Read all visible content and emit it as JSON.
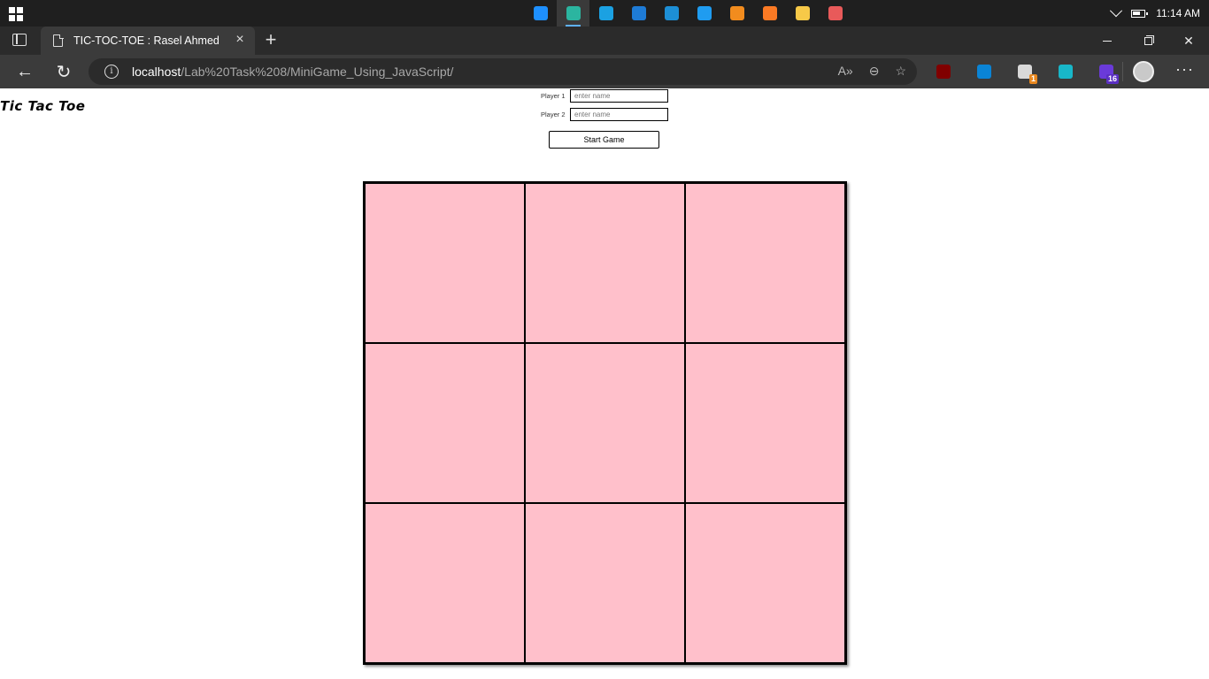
{
  "taskbar": {
    "time": "11:14 AM",
    "apps": [
      {
        "icon": "task-view-icon",
        "color": "#1e90ff",
        "active": false
      },
      {
        "icon": "edge-icon",
        "color": "#2bb5a0",
        "active": true
      },
      {
        "icon": "quick-assist-icon",
        "color": "#1ba1e2",
        "active": false
      },
      {
        "icon": "remote-desktop-icon",
        "color": "#1e7bd6",
        "active": false
      },
      {
        "icon": "camera-icon",
        "color": "#1d8fd6",
        "active": false
      },
      {
        "icon": "vscode-icon",
        "color": "#1f9cf0",
        "active": false
      },
      {
        "icon": "sublime-text-icon",
        "color": "#f28c1e",
        "active": false
      },
      {
        "icon": "xampp-icon",
        "color": "#fb7a24",
        "active": false
      },
      {
        "icon": "file-explorer-icon",
        "color": "#f7c948",
        "active": false
      },
      {
        "icon": "paint-icon",
        "color": "#e85a5a",
        "active": false
      }
    ]
  },
  "browser": {
    "tab_title": "TIC-TOC-TOE : Rasel Ahmed",
    "url_host": "localhost",
    "url_path": "/Lab%20Task%208/MiniGame_Using_JavaScript/",
    "extensions": [
      {
        "icon": "ublock-origin-icon",
        "color": "#800000",
        "badge": ""
      },
      {
        "icon": "skype-s-icon",
        "color": "#0a84d6",
        "badge": ""
      },
      {
        "icon": "extension-badge-icon",
        "color": "#d9d9d9",
        "badge": "1",
        "badge_color": "#e8871e"
      },
      {
        "icon": "quick-share-icon",
        "color": "#18b7c9",
        "badge": ""
      },
      {
        "icon": "purple-extension-icon",
        "color": "#6a3ad9",
        "badge": "16",
        "badge_color": "#5a2fc2"
      }
    ]
  },
  "page": {
    "title": "Tic Tac Toe",
    "player1_label": "Player 1",
    "player1_placeholder": "enter name",
    "player2_label": "Player 2",
    "player2_placeholder": "enter name",
    "start_button": "Start Game",
    "cell_color": "#ffc0cb",
    "cells": [
      "",
      "",
      "",
      "",
      "",
      "",
      "",
      "",
      ""
    ]
  }
}
